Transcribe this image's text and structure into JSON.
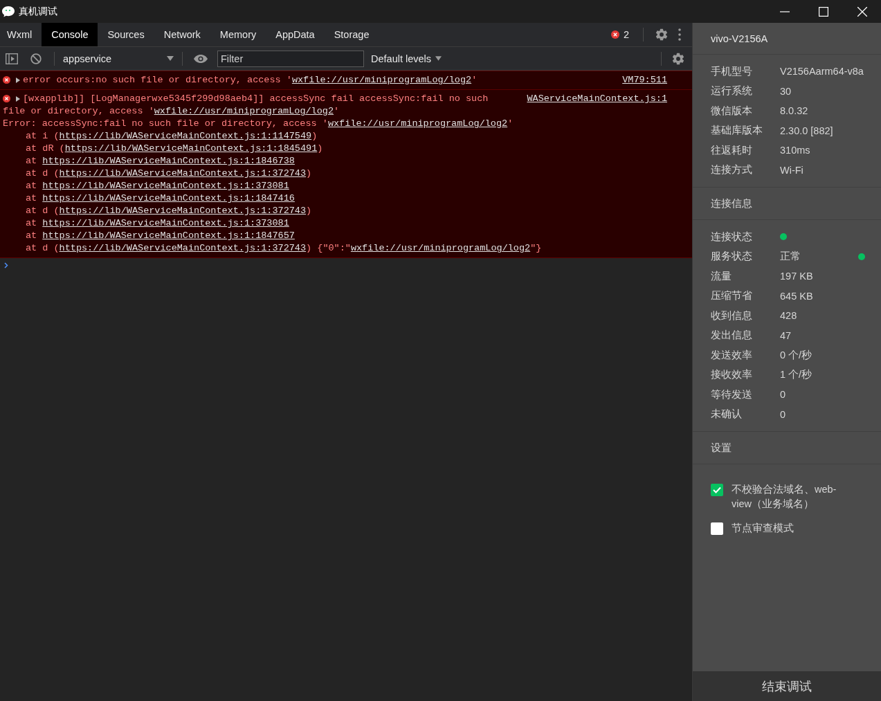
{
  "window": {
    "title": "真机调试"
  },
  "tabs": [
    {
      "label": "Wxml",
      "selected": false
    },
    {
      "label": "Console",
      "selected": true
    },
    {
      "label": "Sources",
      "selected": false
    },
    {
      "label": "Network",
      "selected": false
    },
    {
      "label": "Memory",
      "selected": false
    },
    {
      "label": "AppData",
      "selected": false
    },
    {
      "label": "Storage",
      "selected": false
    }
  ],
  "error_count": "2",
  "toolbar": {
    "context": "appservice",
    "filter": {
      "placeholder": "Filter"
    },
    "levels": "Default levels"
  },
  "console": {
    "messages": [
      {
        "source": "VM79:511",
        "lines": [
          [
            {
              "kind": "text",
              "text": "error occurs:no such file or directory, access '"
            },
            {
              "kind": "link",
              "text": "wxfile://usr/miniprogramLog/log2"
            },
            {
              "kind": "text",
              "text": "'"
            }
          ]
        ]
      },
      {
        "source": "WAServiceMainContext.js:1",
        "lines": [
          [
            {
              "kind": "text",
              "text": "[wxapplib]] [LogManagerwxe5345f299d98aeb4]] accessSync fail accessSync:fail no such"
            }
          ],
          [
            {
              "kind": "text",
              "text": "file or directory, access '"
            },
            {
              "kind": "link",
              "text": "wxfile://usr/miniprogramLog/log2"
            },
            {
              "kind": "text",
              "text": "'"
            }
          ],
          [
            {
              "kind": "text",
              "text": "Error: accessSync:fail no such file or directory, access '"
            },
            {
              "kind": "link",
              "text": "wxfile://usr/miniprogramLog/log2"
            },
            {
              "kind": "text",
              "text": "'"
            }
          ]
        ],
        "stack": [
          [
            {
              "kind": "text",
              "text": "at i ("
            },
            {
              "kind": "link",
              "text": "https://lib/WAServiceMainContext.js:1:1147549"
            },
            {
              "kind": "text",
              "text": ")"
            }
          ],
          [
            {
              "kind": "text",
              "text": "at dR ("
            },
            {
              "kind": "link",
              "text": "https://lib/WAServiceMainContext.js:1:1845491"
            },
            {
              "kind": "text",
              "text": ")"
            }
          ],
          [
            {
              "kind": "text",
              "text": "at "
            },
            {
              "kind": "link",
              "text": "https://lib/WAServiceMainContext.js:1:1846738"
            }
          ],
          [
            {
              "kind": "text",
              "text": "at d ("
            },
            {
              "kind": "link",
              "text": "https://lib/WAServiceMainContext.js:1:372743"
            },
            {
              "kind": "text",
              "text": ")"
            }
          ],
          [
            {
              "kind": "text",
              "text": "at "
            },
            {
              "kind": "link",
              "text": "https://lib/WAServiceMainContext.js:1:373081"
            }
          ],
          [
            {
              "kind": "text",
              "text": "at "
            },
            {
              "kind": "link",
              "text": "https://lib/WAServiceMainContext.js:1:1847416"
            }
          ],
          [
            {
              "kind": "text",
              "text": "at d ("
            },
            {
              "kind": "link",
              "text": "https://lib/WAServiceMainContext.js:1:372743"
            },
            {
              "kind": "text",
              "text": ")"
            }
          ],
          [
            {
              "kind": "text",
              "text": "at "
            },
            {
              "kind": "link",
              "text": "https://lib/WAServiceMainContext.js:1:373081"
            }
          ],
          [
            {
              "kind": "text",
              "text": "at "
            },
            {
              "kind": "link",
              "text": "https://lib/WAServiceMainContext.js:1:1847657"
            }
          ],
          [
            {
              "kind": "text",
              "text": "at d ("
            },
            {
              "kind": "link",
              "text": "https://lib/WAServiceMainContext.js:1:372743"
            },
            {
              "kind": "text",
              "text": ") {\"0\":\""
            },
            {
              "kind": "link",
              "text": "wxfile://usr/miniprogramLog/log2"
            },
            {
              "kind": "text",
              "text": "\"}"
            }
          ]
        ]
      }
    ]
  },
  "device": {
    "name": "vivo-V2156A",
    "info": [
      {
        "label": "手机型号",
        "value": "V2156Aarm64-v8a"
      },
      {
        "label": "运行系统",
        "value": "30"
      },
      {
        "label": "微信版本",
        "value": "8.0.32"
      },
      {
        "label": "基础库版本",
        "value": "2.30.0 [882]"
      },
      {
        "label": "往返耗时",
        "value": "310ms"
      },
      {
        "label": "连接方式",
        "value": "Wi-Fi"
      }
    ]
  },
  "connection": {
    "title": "连接信息",
    "rows": [
      {
        "kind": "status",
        "label": "连接状态",
        "color": "#07c160"
      },
      {
        "kind": "status_text",
        "label": "服务状态",
        "value": "正常",
        "color": "#07c160"
      },
      {
        "kind": "text",
        "label": "流量",
        "value": "197 KB"
      },
      {
        "kind": "text",
        "label": "压缩节省",
        "value": "645 KB"
      },
      {
        "kind": "text",
        "label": "收到信息",
        "value": "428"
      },
      {
        "kind": "text",
        "label": "发出信息",
        "value": "47"
      },
      {
        "kind": "text",
        "label": "发送效率",
        "value": "0 个/秒"
      },
      {
        "kind": "text",
        "label": "接收效率",
        "value": "1 个/秒"
      },
      {
        "kind": "text",
        "label": "等待发送",
        "value": "0"
      },
      {
        "kind": "text",
        "label": "未确认",
        "value": "0"
      }
    ]
  },
  "settings": {
    "title": "设置",
    "options": [
      {
        "label": "不校验合法域名、web-view（业务域名）",
        "checked": true
      },
      {
        "label": "节点审查模式",
        "checked": false
      }
    ]
  },
  "end_button": "结束调试"
}
